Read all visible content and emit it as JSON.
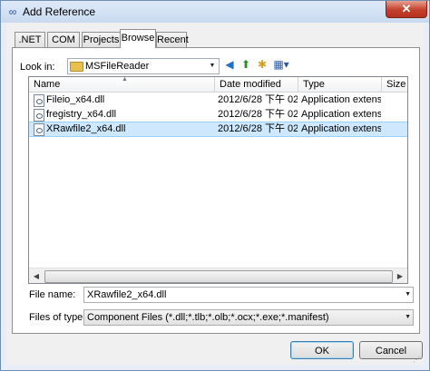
{
  "window": {
    "title": "Add Reference",
    "close_label": "✕"
  },
  "tabs": [
    {
      "label": ".NET"
    },
    {
      "label": "COM"
    },
    {
      "label": "Projects"
    },
    {
      "label": "Browse"
    },
    {
      "label": "Recent"
    }
  ],
  "active_tab": "Browse",
  "look_in": {
    "label": "Look in:",
    "value": "MSFileReader"
  },
  "toolbar": {
    "back_icon": "back-arrow-icon",
    "up_icon": "up-folder-icon",
    "new_folder_icon": "new-folder-icon",
    "views_icon": "views-menu-icon"
  },
  "file_list": {
    "columns": [
      "Name",
      "Date modified",
      "Type",
      "Size"
    ],
    "rows": [
      {
        "name": "Fileio_x64.dll",
        "date": "2012/6/28 下午 02:...",
        "type": "Application extens...",
        "size": ""
      },
      {
        "name": "fregistry_x64.dll",
        "date": "2012/6/28 下午 02:...",
        "type": "Application extens...",
        "size": ""
      },
      {
        "name": "XRawfile2_x64.dll",
        "date": "2012/6/28 下午 02:...",
        "type": "Application extens...",
        "size": ""
      }
    ],
    "selected_row": 2
  },
  "file_name": {
    "label": "File name:",
    "value": "XRawfile2_x64.dll"
  },
  "file_type": {
    "label": "Files of type:",
    "value": "Component Files (*.dll;*.tlb;*.olb;*.ocx;*.exe;*.manifest)"
  },
  "buttons": {
    "ok": "OK",
    "cancel": "Cancel"
  },
  "colors": {
    "selection": "#cde8ff",
    "close": "#c4402c"
  }
}
